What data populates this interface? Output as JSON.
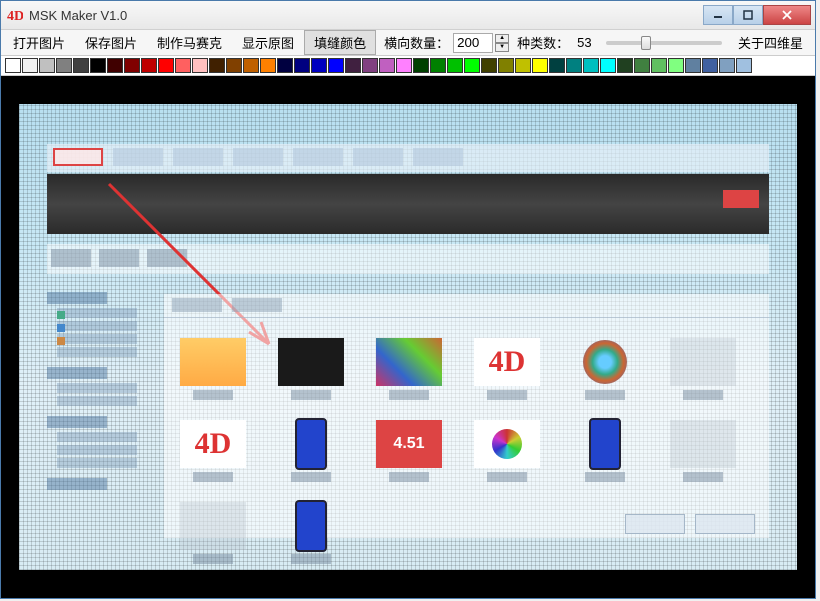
{
  "window": {
    "title": "MSK Maker V1.0"
  },
  "toolbar": {
    "open": "打开图片",
    "save": "保存图片",
    "make": "制作马赛克",
    "show_orig": "显示原图",
    "fill_color": "填缝颜色",
    "hcount_label": "横向数量：",
    "hcount_value": "200",
    "kinds_label": "种类数：",
    "kinds_value": "53",
    "about": "关于四维星"
  },
  "palette": [
    "#ffffff",
    "#f0f0f0",
    "#c0c0c0",
    "#808080",
    "#404040",
    "#000000",
    "#400000",
    "#800000",
    "#c00000",
    "#ff0000",
    "#ff6060",
    "#ffc0c0",
    "#402000",
    "#804000",
    "#c06000",
    "#ff8000",
    "#000040",
    "#000080",
    "#0000c0",
    "#0000ff",
    "#402040",
    "#804080",
    "#c060c0",
    "#ff80ff",
    "#004000",
    "#008000",
    "#00c000",
    "#00ff00",
    "#404000",
    "#808000",
    "#c0c000",
    "#ffff00",
    "#004040",
    "#008080",
    "#00c0c0",
    "#00ffff",
    "#204020",
    "#408040",
    "#60c060",
    "#80ff80",
    "#6080a0",
    "#4060a0",
    "#80a0c0",
    "#a0c0e0"
  ],
  "mosaic": {
    "red_number": "4.51"
  }
}
